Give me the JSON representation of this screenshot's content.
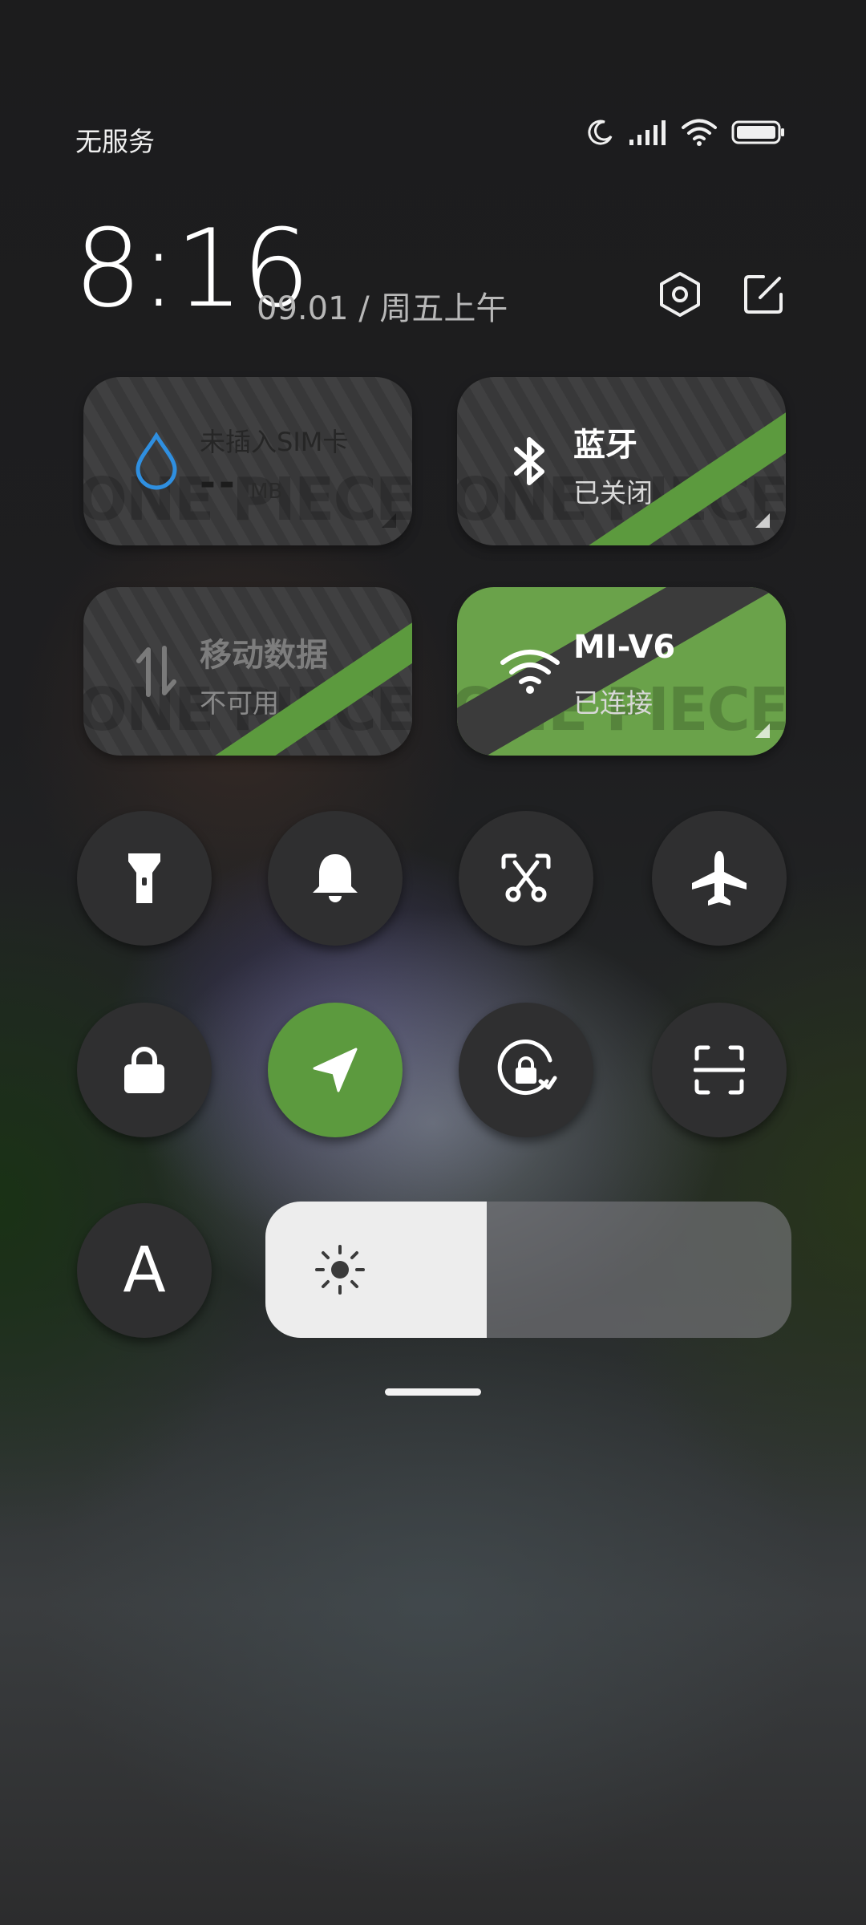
{
  "status_bar": {
    "carrier": "无服务",
    "icons": [
      "moon-icon",
      "signal-icon",
      "wifi-icon",
      "battery-icon"
    ]
  },
  "header": {
    "time": "8:16",
    "date": "09.01 / 周五上午",
    "settings_icon": "hexagon-settings-icon",
    "edit_icon": "edit-icon"
  },
  "tiles": {
    "data_usage": {
      "title": "未插入SIM卡",
      "value": "--",
      "unit": "MB",
      "icon": "drop-icon"
    },
    "bluetooth": {
      "title": "蓝牙",
      "status": "已关闭",
      "icon": "bluetooth-icon"
    },
    "mobile_data": {
      "title": "移动数据",
      "status": "不可用",
      "icon": "arrows-updown-icon"
    },
    "wifi": {
      "title": "MI-V6",
      "status": "已连接",
      "icon": "wifi-icon"
    },
    "watermark": "ONE PIECE ONE"
  },
  "toggles": {
    "row1": [
      "flashlight-icon",
      "bell-icon",
      "screenshot-icon",
      "airplane-icon"
    ],
    "row2": [
      "lock-icon",
      "location-icon",
      "rotation-lock-icon",
      "scan-icon"
    ],
    "font_size_label": "A"
  },
  "brightness": {
    "level_fraction": 0.42,
    "icon": "sun-icon"
  },
  "colors": {
    "accent_green": "#5c9a3e",
    "drop_blue": "#2f8fe0"
  }
}
